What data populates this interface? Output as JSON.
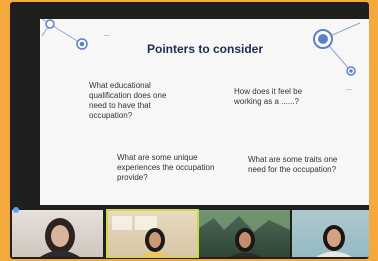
{
  "slide": {
    "title": "Pointers to consider",
    "dots_left": "...",
    "dots_right": "...",
    "questions": [
      "What educational qualification does one need to have that occupation?",
      "How does it feel be working as a ......?",
      "What are some unique experiences the occupation provide?",
      "What are some traits one need for the occupation?"
    ]
  },
  "participants": [
    {
      "name": "",
      "active": false
    },
    {
      "name": "",
      "active": true
    },
    {
      "name": "",
      "active": false
    },
    {
      "name": "",
      "active": false
    }
  ],
  "colors": {
    "background": "#f3a93e",
    "slide_title": "#1d2d4f",
    "accent": "#5b80c8",
    "active_outline": "#d4d64a"
  }
}
